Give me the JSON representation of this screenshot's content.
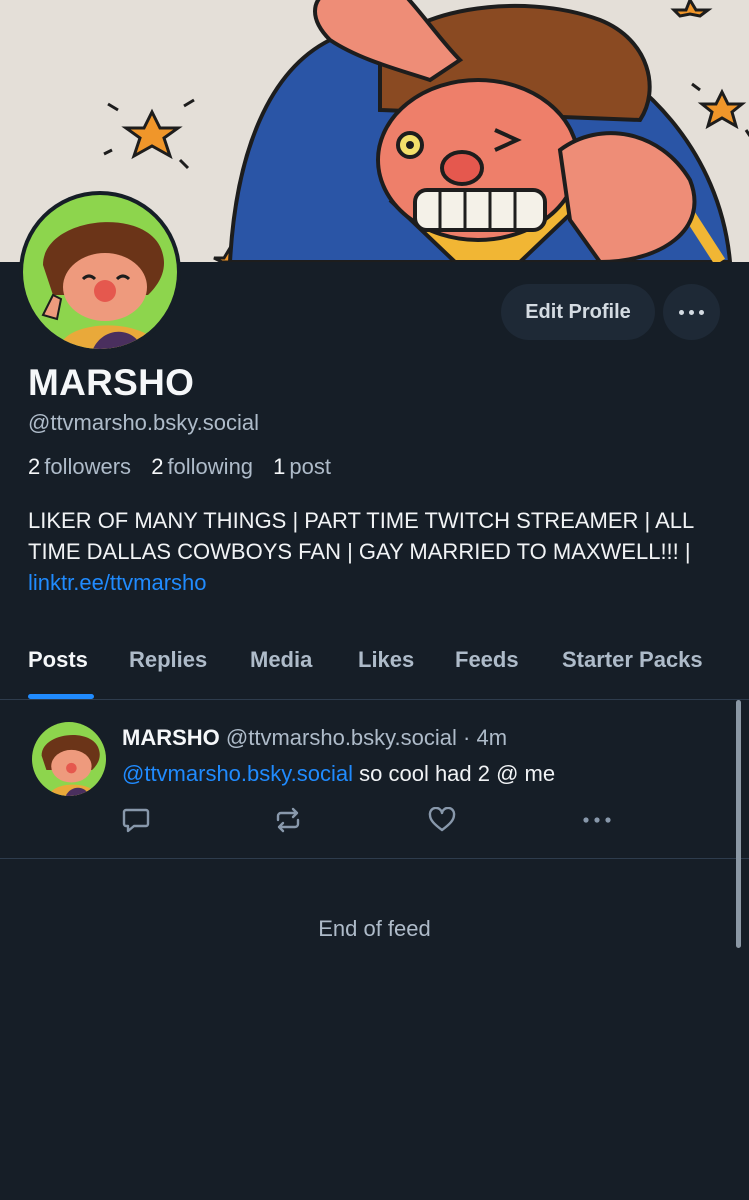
{
  "profile": {
    "display_name": "MARSHO",
    "handle": "@ttvmarsho.bsky.social",
    "followers_count": "2",
    "followers_label": "followers",
    "following_count": "2",
    "following_label": "following",
    "posts_count": "1",
    "posts_label": "post",
    "bio_text": "LIKER OF MANY THINGS | PART TIME TWITCH STREAMER | ALL TIME DALLAS COWBOYS FAN | GAY MARRIED TO MAXWELL!!! | ",
    "bio_link": "linktr.ee/ttvmarsho",
    "edit_profile_label": "Edit Profile",
    "more_icon": "ellipsis-icon"
  },
  "tabs": [
    {
      "label": "Posts",
      "active": true
    },
    {
      "label": "Replies",
      "active": false
    },
    {
      "label": "Media",
      "active": false
    },
    {
      "label": "Likes",
      "active": false
    },
    {
      "label": "Feeds",
      "active": false
    },
    {
      "label": "Starter Packs",
      "active": false
    }
  ],
  "feed": {
    "posts": [
      {
        "author_name": "MARSHO",
        "author_handle": "@ttvmarsho.bsky.social",
        "separator": "·",
        "time": "4m",
        "mention": "@ttvmarsho.bsky.social",
        "text": "so cool had 2 @ me",
        "actions": [
          "reply-icon",
          "repost-icon",
          "like-icon",
          "more-icon"
        ]
      }
    ],
    "end_label": "End of feed"
  },
  "colors": {
    "background": "#161e27",
    "accent": "#208bfe",
    "muted_text": "#aebbc9",
    "button_bg": "#1e2936",
    "divider": "#2e3c4d"
  }
}
